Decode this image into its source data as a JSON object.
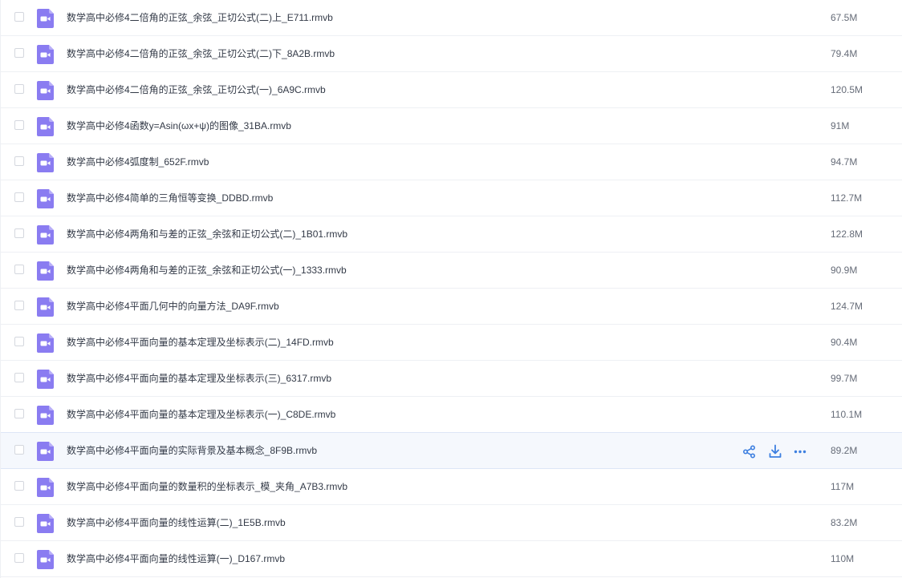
{
  "colors": {
    "accent": "#3d7fe0",
    "file_icon": "#8a7cf1",
    "row_hover": "#f5f8fd"
  },
  "files": [
    {
      "name": "数学高中必修4二倍角的正弦_余弦_正切公式(二)上_E711.rmvb",
      "size": "67.5M",
      "icon": "video-file-icon"
    },
    {
      "name": "数学高中必修4二倍角的正弦_余弦_正切公式(二)下_8A2B.rmvb",
      "size": "79.4M",
      "icon": "video-file-icon"
    },
    {
      "name": "数学高中必修4二倍角的正弦_余弦_正切公式(一)_6A9C.rmvb",
      "size": "120.5M",
      "icon": "video-file-icon"
    },
    {
      "name": "数学高中必修4函数y=Asin(ωx+ψ)的图像_31BA.rmvb",
      "size": "91M",
      "icon": "video-file-icon"
    },
    {
      "name": "数学高中必修4弧度制_652F.rmvb",
      "size": "94.7M",
      "icon": "video-file-icon"
    },
    {
      "name": "数学高中必修4简单的三角恒等变换_DDBD.rmvb",
      "size": "112.7M",
      "icon": "video-file-icon"
    },
    {
      "name": "数学高中必修4两角和与差的正弦_余弦和正切公式(二)_1B01.rmvb",
      "size": "122.8M",
      "icon": "video-file-icon"
    },
    {
      "name": "数学高中必修4两角和与差的正弦_余弦和正切公式(一)_1333.rmvb",
      "size": "90.9M",
      "icon": "video-file-icon"
    },
    {
      "name": "数学高中必修4平面几何中的向量方法_DA9F.rmvb",
      "size": "124.7M",
      "icon": "video-file-icon"
    },
    {
      "name": "数学高中必修4平面向量的基本定理及坐标表示(二)_14FD.rmvb",
      "size": "90.4M",
      "icon": "video-file-icon"
    },
    {
      "name": "数学高中必修4平面向量的基本定理及坐标表示(三)_6317.rmvb",
      "size": "99.7M",
      "icon": "video-file-icon"
    },
    {
      "name": "数学高中必修4平面向量的基本定理及坐标表示(一)_C8DE.rmvb",
      "size": "110.1M",
      "icon": "video-file-icon"
    },
    {
      "name": "数学高中必修4平面向量的实际背景及基本概念_8F9B.rmvb",
      "size": "89.2M",
      "icon": "video-file-icon",
      "hovered": true,
      "actions": [
        "share-icon",
        "download-icon",
        "more-icon"
      ]
    },
    {
      "name": "数学高中必修4平面向量的数量积的坐标表示_模_夹角_A7B3.rmvb",
      "size": "117M",
      "icon": "video-file-icon"
    },
    {
      "name": "数学高中必修4平面向量的线性运算(二)_1E5B.rmvb",
      "size": "83.2M",
      "icon": "video-file-icon"
    },
    {
      "name": "数学高中必修4平面向量的线性运算(一)_D167.rmvb",
      "size": "110M",
      "icon": "video-file-icon"
    }
  ]
}
